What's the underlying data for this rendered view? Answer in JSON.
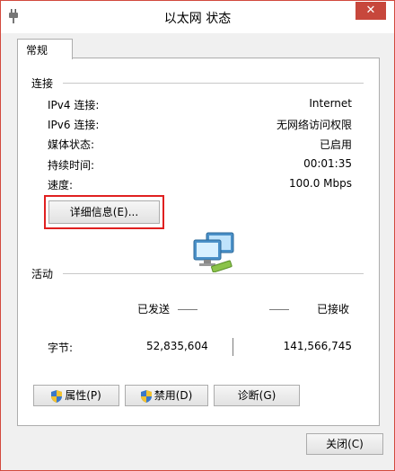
{
  "window": {
    "title": "以太网 状态",
    "close_label": "✕"
  },
  "tab": {
    "label": "常规"
  },
  "connection": {
    "section_label": "连接",
    "rows": [
      {
        "label": "IPv4 连接:",
        "value": "Internet"
      },
      {
        "label": "IPv6 连接:",
        "value": "无网络访问权限"
      },
      {
        "label": "媒体状态:",
        "value": "已启用"
      },
      {
        "label": "持续时间:",
        "value": "00:01:35"
      },
      {
        "label": "速度:",
        "value": "100.0 Mbps"
      }
    ],
    "details_button": "详细信息(E)..."
  },
  "activity": {
    "section_label": "活动",
    "sent_label": "已发送",
    "received_label": "已接收",
    "bytes_label": "字节:",
    "bytes_sent": "52,835,604",
    "bytes_received": "141,566,745"
  },
  "buttons": {
    "properties": "属性(P)",
    "disable": "禁用(D)",
    "diagnose": "诊断(G)",
    "close": "关闭(C)"
  },
  "icons": {
    "app": "network-plug-icon",
    "network": "network-computers-icon",
    "shield": "uac-shield-icon"
  },
  "colors": {
    "close_button": "#c7473c",
    "highlight_border": "#e02020"
  }
}
